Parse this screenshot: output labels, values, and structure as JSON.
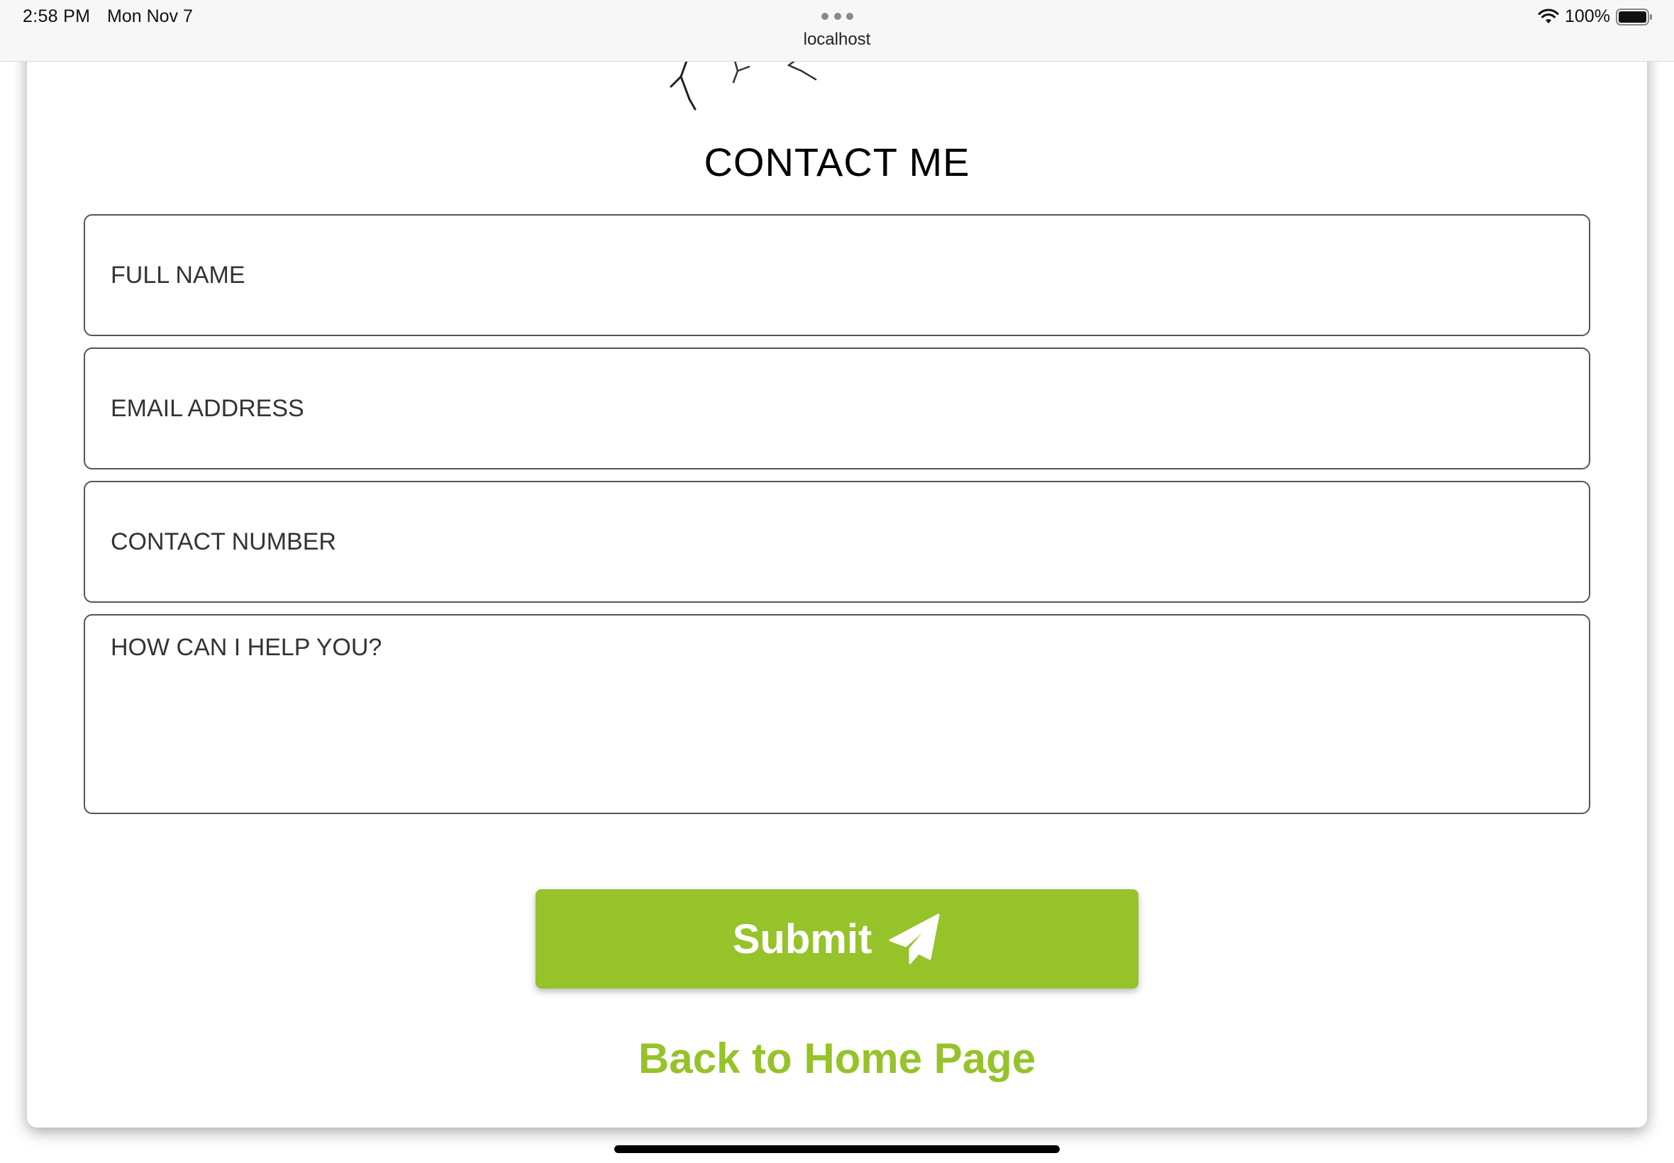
{
  "status_bar": {
    "time": "2:58 PM",
    "date": "Mon Nov 7",
    "address": "localhost",
    "battery": "100%"
  },
  "page": {
    "title": "CONTACT ME",
    "form": {
      "full_name_placeholder": "FULL NAME",
      "email_placeholder": "EMAIL ADDRESS",
      "contact_number_placeholder": "CONTACT NUMBER",
      "message_placeholder": "HOW CAN I HELP YOU?",
      "submit_label": "Submit"
    },
    "back_link_label": "Back to Home Page"
  },
  "colors": {
    "accent": "#96c22a",
    "text": "#333333",
    "border": "#555555"
  },
  "icons": {
    "submit": "paper-plane-icon",
    "wifi": "wifi-icon",
    "battery": "battery-icon"
  }
}
